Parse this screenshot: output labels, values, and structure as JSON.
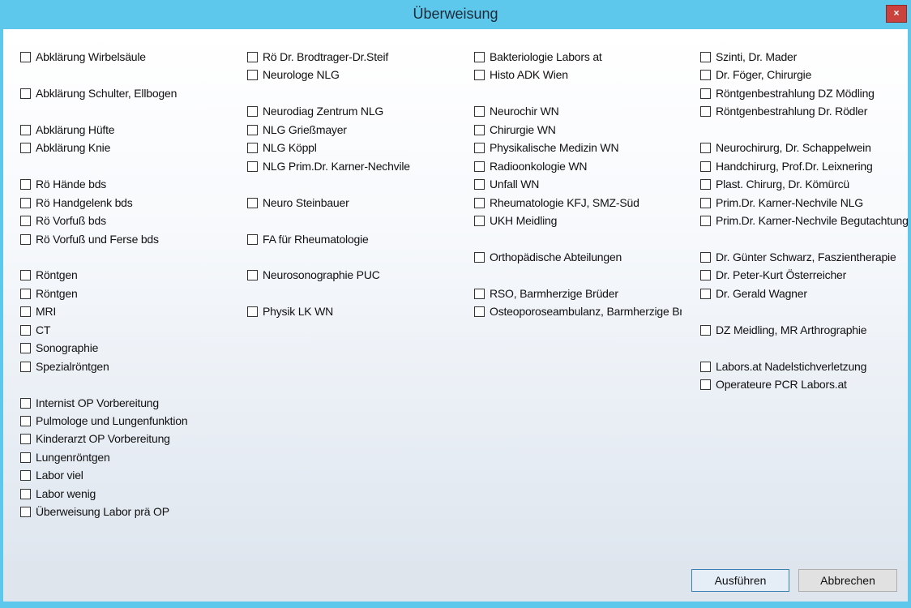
{
  "window": {
    "title": "Überweisung",
    "close_label": "×"
  },
  "columns": [
    {
      "items": [
        {
          "slot": 0,
          "label": "Abklärung Wirbelsäule"
        },
        {
          "slot": 2,
          "label": "Abklärung Schulter, Ellbogen"
        },
        {
          "slot": 4,
          "label": "Abklärung Hüfte"
        },
        {
          "slot": 5,
          "label": "Abklärung Knie"
        },
        {
          "slot": 7,
          "label": "Rö Hände bds"
        },
        {
          "slot": 8,
          "label": "Rö Handgelenk bds"
        },
        {
          "slot": 9,
          "label": "Rö Vorfuß bds"
        },
        {
          "slot": 10,
          "label": "Rö Vorfuß und Ferse bds"
        },
        {
          "slot": 12,
          "label": "Röntgen"
        },
        {
          "slot": 13,
          "label": "Röntgen"
        },
        {
          "slot": 14,
          "label": "MRI"
        },
        {
          "slot": 15,
          "label": "CT"
        },
        {
          "slot": 16,
          "label": "Sonographie"
        },
        {
          "slot": 17,
          "label": "Spezialröntgen"
        },
        {
          "slot": 19,
          "label": "Internist OP Vorbereitung"
        },
        {
          "slot": 20,
          "label": "Pulmologe und Lungenfunktion"
        },
        {
          "slot": 21,
          "label": "Kinderarzt OP Vorbereitung"
        },
        {
          "slot": 22,
          "label": "Lungenröntgen"
        },
        {
          "slot": 23,
          "label": "Labor viel"
        },
        {
          "slot": 24,
          "label": "Labor wenig"
        },
        {
          "slot": 25,
          "label": "Überweisung Labor prä OP"
        }
      ]
    },
    {
      "items": [
        {
          "slot": 0,
          "label": "Rö Dr. Brodtrager-Dr.Steif"
        },
        {
          "slot": 1,
          "label": "Neurologe NLG"
        },
        {
          "slot": 3,
          "label": "Neurodiag Zentrum NLG"
        },
        {
          "slot": 4,
          "label": "NLG Grießmayer"
        },
        {
          "slot": 5,
          "label": "NLG Köppl"
        },
        {
          "slot": 6,
          "label": "NLG Prim.Dr. Karner-Nechvile"
        },
        {
          "slot": 8,
          "label": "Neuro Steinbauer"
        },
        {
          "slot": 10,
          "label": "FA für Rheumatologie"
        },
        {
          "slot": 12,
          "label": "Neurosonographie PUC"
        },
        {
          "slot": 14,
          "label": "Physik LK WN"
        }
      ]
    },
    {
      "items": [
        {
          "slot": 0,
          "label": "Bakteriologie Labors at"
        },
        {
          "slot": 1,
          "label": "Histo ADK Wien"
        },
        {
          "slot": 3,
          "label": "Neurochir WN"
        },
        {
          "slot": 4,
          "label": "Chirurgie WN"
        },
        {
          "slot": 5,
          "label": "Physikalische Medizin WN"
        },
        {
          "slot": 6,
          "label": "Radioonkologie WN"
        },
        {
          "slot": 7,
          "label": "Unfall WN"
        },
        {
          "slot": 8,
          "label": "Rheumatologie KFJ, SMZ-Süd"
        },
        {
          "slot": 9,
          "label": "UKH Meidling"
        },
        {
          "slot": 11,
          "label": "Orthopädische Abteilungen"
        },
        {
          "slot": 13,
          "label": "RSO, Barmherzige Brüder"
        },
        {
          "slot": 14,
          "label": "Osteoporoseambulanz, Barmherzige Brüd"
        }
      ]
    },
    {
      "items": [
        {
          "slot": 0,
          "label": "Szinti, Dr. Mader"
        },
        {
          "slot": 1,
          "label": "Dr. Föger, Chirurgie"
        },
        {
          "slot": 2,
          "label": "Röntgenbestrahlung DZ Mödling"
        },
        {
          "slot": 3,
          "label": "Röntgenbestrahlung Dr. Rödler"
        },
        {
          "slot": 5,
          "label": "Neurochirurg, Dr. Schappelwein"
        },
        {
          "slot": 6,
          "label": "Handchirurg, Prof.Dr. Leixnering"
        },
        {
          "slot": 7,
          "label": "Plast. Chirurg, Dr. Kömürcü"
        },
        {
          "slot": 8,
          "label": "Prim.Dr. Karner-Nechvile NLG"
        },
        {
          "slot": 9,
          "label": "Prim.Dr. Karner-Nechvile Begutachtung"
        },
        {
          "slot": 11,
          "label": "Dr. Günter Schwarz, Faszientherapie"
        },
        {
          "slot": 12,
          "label": "Dr. Peter-Kurt Österreicher"
        },
        {
          "slot": 13,
          "label": "Dr. Gerald Wagner"
        },
        {
          "slot": 15,
          "label": "DZ Meidling, MR Arthrographie"
        },
        {
          "slot": 17,
          "label": "Labors.at Nadelstichverletzung"
        },
        {
          "slot": 18,
          "label": "Operateure PCR Labors.at"
        }
      ]
    }
  ],
  "buttons": {
    "ok": "Ausführen",
    "cancel": "Abbrechen"
  }
}
